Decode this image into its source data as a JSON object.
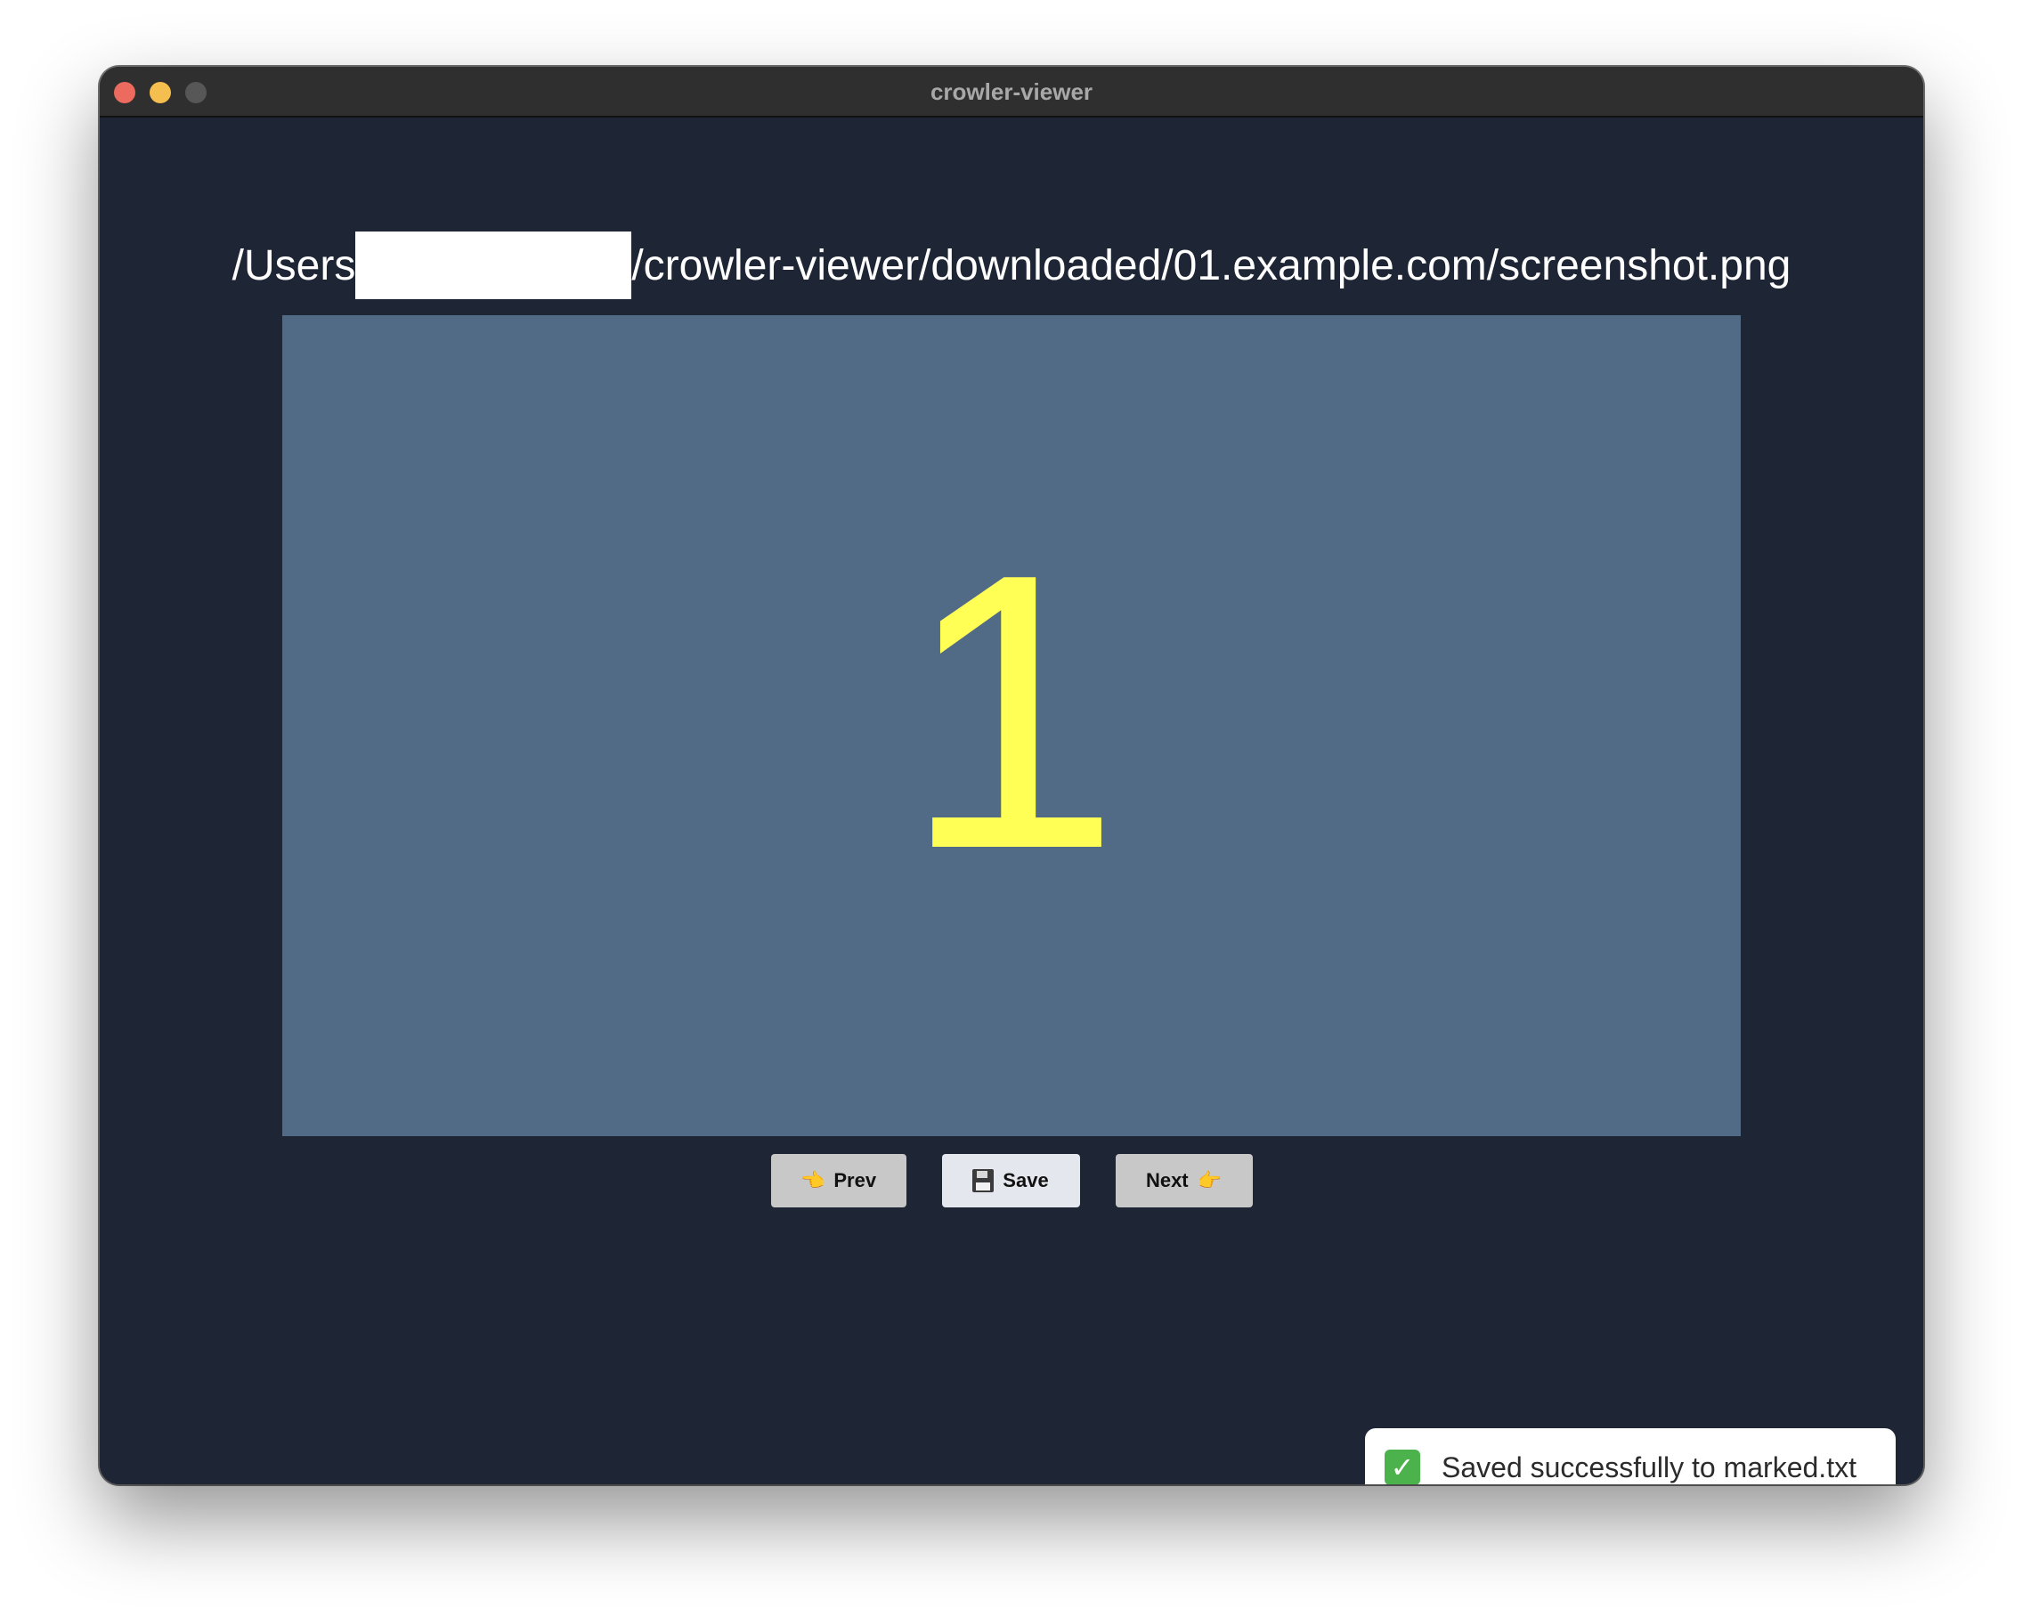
{
  "window": {
    "title": "crowler-viewer"
  },
  "path": {
    "prefix": "/Users",
    "suffix": "/crowler-viewer/downloaded/01.example.com/screenshot.png"
  },
  "image": {
    "content_text": "1"
  },
  "buttons": {
    "prev_label": "Prev",
    "prev_icon": "👈",
    "save_label": "Save",
    "next_label": "Next",
    "next_icon": "👉"
  },
  "toast": {
    "message": "Saved successfully to marked.txt",
    "icon": "✓"
  },
  "colors": {
    "background": "#1e2636",
    "image_bg": "#516b87",
    "digit": "#ffff55",
    "toast_check": "#4cb24c"
  }
}
